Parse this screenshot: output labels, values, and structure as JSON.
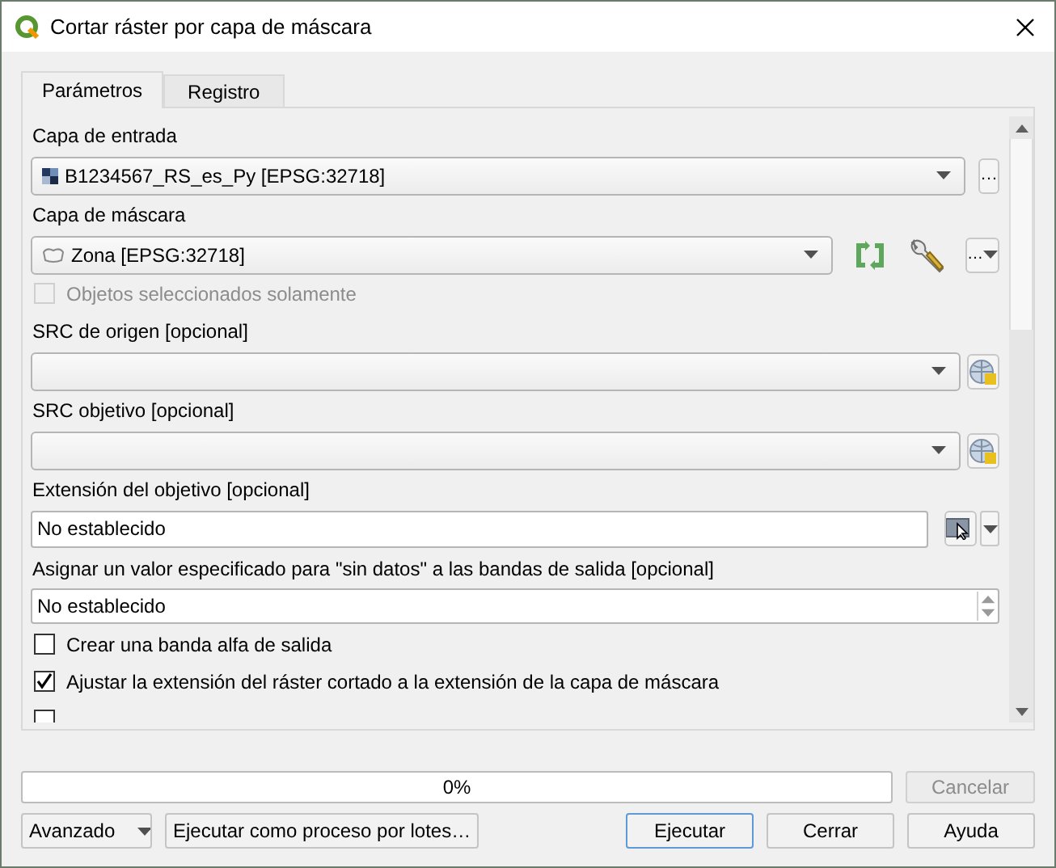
{
  "window": {
    "title": "Cortar ráster por capa de máscara"
  },
  "tabs": [
    {
      "label": "Parámetros",
      "selected": true
    },
    {
      "label": "Registro",
      "selected": false
    }
  ],
  "parameters": [
    {
      "kind": "raster_layer",
      "label": "Capa de entrada",
      "value": "B1234567_RS_es_Py [EPSG:32718]",
      "button_text": "…"
    },
    {
      "kind": "vector_layer",
      "label": "Capa de máscara",
      "value": "Zona [EPSG:32718]",
      "button_text": "…"
    },
    {
      "kind": "checkbox",
      "label": "Objetos seleccionados solamente",
      "checked": false,
      "disabled": true
    },
    {
      "kind": "crs",
      "label": "SRC de origen [opcional]"
    },
    {
      "kind": "crs",
      "label": "SRC objetivo [opcional]"
    },
    {
      "kind": "extent",
      "label": "Extensión del objetivo [opcional]",
      "value": "No establecido"
    },
    {
      "kind": "spin",
      "label": "Asignar un valor especificado para \"sin datos\" a las bandas de salida [opcional]",
      "value": "No establecido"
    },
    {
      "kind": "checkbox",
      "label": "Crear una banda alfa de salida",
      "checked": false,
      "disabled": false
    },
    {
      "kind": "checkbox",
      "label": "Ajustar la extensión del ráster cortado a la extensión de la capa de máscara",
      "checked": true,
      "disabled": false
    },
    {
      "kind": "checkbox",
      "checked": false,
      "disabled": false
    }
  ],
  "progress": {
    "level": 0,
    "text": "0%"
  },
  "cancel": {
    "label": "Cancelar",
    "disabled": true
  },
  "buttons": [
    {
      "kind": "menu",
      "label": "Avanzado"
    },
    {
      "kind": "plain",
      "label": "Ejecutar como proceso por lotes…"
    },
    {
      "kind": "spacer"
    },
    {
      "kind": "default",
      "label": "Ejecutar"
    },
    {
      "kind": "plain",
      "label": "Cerrar"
    },
    {
      "kind": "plain",
      "label": "Ayuda"
    }
  ]
}
